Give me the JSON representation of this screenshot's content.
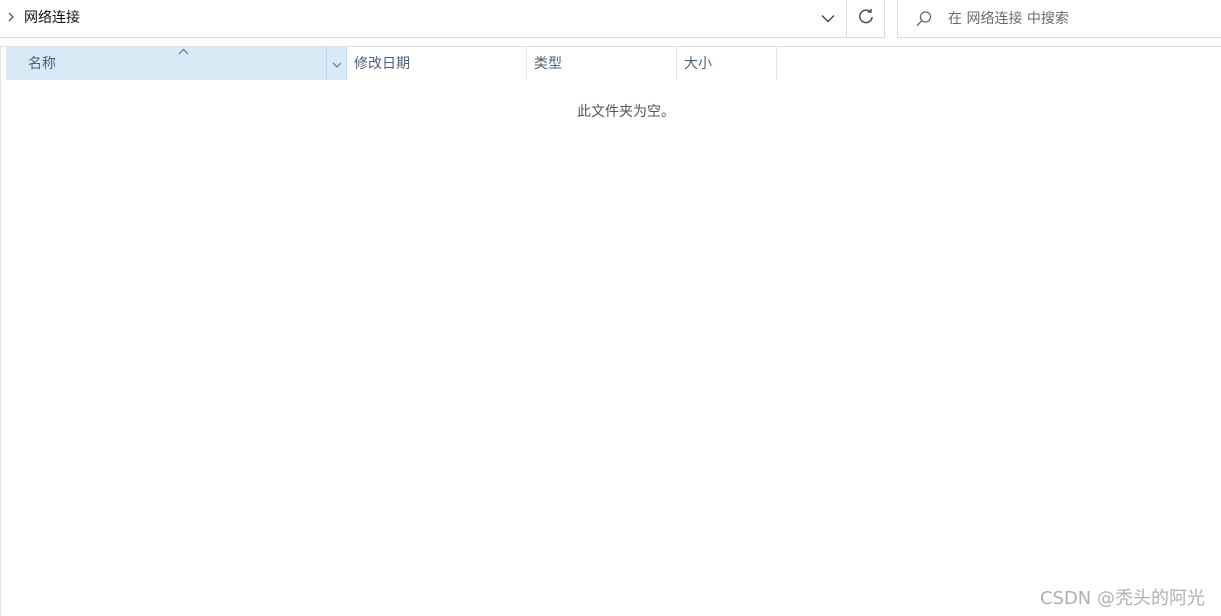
{
  "address_bar": {
    "breadcrumb": [
      "网络连接"
    ],
    "history_icon": "chevron-down-icon",
    "refresh_icon": "refresh-icon"
  },
  "search": {
    "placeholder": "在 网络连接 中搜索",
    "value": "",
    "icon": "search-icon"
  },
  "columns": {
    "name": "名称",
    "date_modified": "修改日期",
    "type": "类型",
    "size": "大小"
  },
  "sort": {
    "column": "name",
    "direction": "ascending"
  },
  "content": {
    "empty_message": "此文件夹为空。"
  },
  "watermark": "CSDN @秃头的阿光",
  "colors": {
    "selected_header_bg": "#d9eaf7",
    "header_text": "#4c607a",
    "border": "#d9d9d9"
  }
}
